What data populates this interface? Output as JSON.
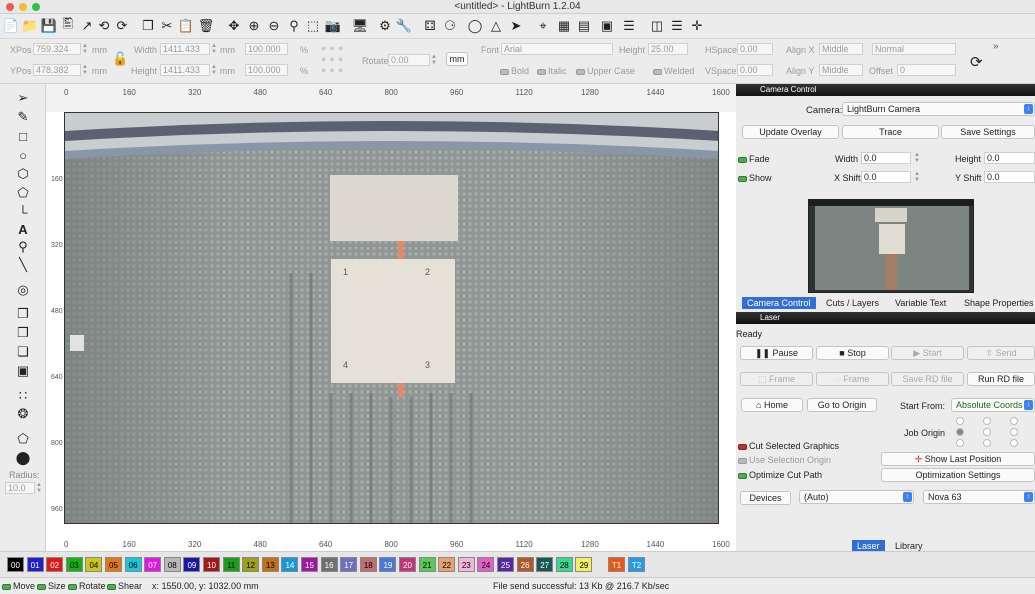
{
  "window": {
    "title": "<untitled> - LightBurn 1.2.04"
  },
  "toolbar": {
    "icons": [
      "new-file-icon",
      "open-file-icon",
      "save-icon",
      "save-as-icon",
      "import-icon",
      "export-icon",
      "undo-icon",
      "redo-icon",
      "copy-icon",
      "cut-icon",
      "paste-icon",
      "delete-icon",
      "move-icon",
      "zoom-in-icon",
      "zoom-out-icon",
      "zoom-frame-icon",
      "camera-icon",
      "monitor-icon",
      "settings-icon",
      "tools-icon",
      "group-icon",
      "ungroup-icon",
      "weld-icon",
      "mirror-icon",
      "send-icon",
      "target-icon",
      "grid-icon",
      "rect-select-icon",
      "align-icon",
      "distribute-icon"
    ]
  },
  "props": {
    "xpos_label": "XPos",
    "xpos_value": "759.324",
    "ypos_label": "YPos",
    "ypos_value": "478.382",
    "unit_mm": "mm",
    "width_label": "Width",
    "width_value": "1411.433",
    "height_label": "Height",
    "height_value": "1411.433",
    "pct_value": "100.000",
    "pct_unit": "%",
    "rotate_label": "Rotate",
    "rotate_value": "0.00",
    "mm_button": "mm",
    "font_label": "Font",
    "font_value": "Arial",
    "fheight_label": "Height",
    "fheight_value": "25.00",
    "hspace_label": "HSpace",
    "hspace_value": "0.00",
    "vspace_label": "VSpace",
    "vspace_value": "0.00",
    "alignx_label": "Align X",
    "alignx_value": "Middle",
    "aligny_label": "Align Y",
    "aligny_value": "Middle",
    "normal_value": "Normal",
    "offset_label": "Offset",
    "offset_value": "0",
    "bold": "Bold",
    "italic": "Italic",
    "upper": "Upper Case",
    "welded": "Welded"
  },
  "ruler": {
    "top": [
      "0",
      "160",
      "320",
      "480",
      "640",
      "800",
      "960",
      "1120",
      "1280",
      "1440",
      "1600"
    ],
    "left": [
      "160",
      "320",
      "480",
      "640",
      "800",
      "960"
    ]
  },
  "camera_panel": {
    "header": "Camera Control",
    "camera_label": "Camera:",
    "camera_value": "LightBurn Camera",
    "update_overlay": "Update Overlay",
    "trace": "Trace",
    "save_settings": "Save Settings",
    "fade": "Fade",
    "show": "Show",
    "width_label": "Width",
    "width_value": "0.0",
    "height_label": "Height",
    "height_value": "0.0",
    "xshift_label": "X Shift",
    "xshift_value": "0.0",
    "yshift_label": "Y Shift",
    "yshift_value": "0.0",
    "tabs": [
      "Camera Control",
      "Cuts / Layers",
      "Variable Text",
      "Shape Properties"
    ]
  },
  "laser_panel": {
    "header": "Laser",
    "status": "Ready",
    "pause": "Pause",
    "stop": "Stop",
    "start": "Start",
    "send": "Send",
    "frame1": "Frame",
    "frame2": "Frame",
    "save_rd": "Save RD file",
    "run_rd": "Run RD file",
    "home": "Home",
    "go_to_origin": "Go to Origin",
    "start_from_label": "Start From:",
    "start_from_value": "Absolute Coords",
    "job_origin_label": "Job Origin",
    "cut_selected": "Cut Selected Graphics",
    "use_selection_origin": "Use Selection Origin",
    "optimize_cut_path": "Optimize Cut Path",
    "show_last_position": "Show Last Position",
    "optimization_settings": "Optimization Settings",
    "devices": "Devices",
    "port_value": "(Auto)",
    "device_value": "Nova 63",
    "tabs": [
      "Laser",
      "Library"
    ]
  },
  "lefttools": {
    "radius_label": "Radius:",
    "radius_value": "10.0"
  },
  "palette": [
    {
      "n": "00",
      "c": "#000000",
      "t": "#ffffff"
    },
    {
      "n": "01",
      "c": "#1f1fcf",
      "t": "#ffffff"
    },
    {
      "n": "02",
      "c": "#e01818",
      "t": "#ffffff"
    },
    {
      "n": "03",
      "c": "#18b018",
      "t": "#000000"
    },
    {
      "n": "04",
      "c": "#c8c818",
      "t": "#000000"
    },
    {
      "n": "05",
      "c": "#e07818",
      "t": "#000000"
    },
    {
      "n": "06",
      "c": "#18c8d8",
      "t": "#000000"
    },
    {
      "n": "07",
      "c": "#e018e0",
      "t": "#ffffff"
    },
    {
      "n": "08",
      "c": "#b8b8b8",
      "t": "#000000"
    },
    {
      "n": "09",
      "c": "#1818a0",
      "t": "#ffffff"
    },
    {
      "n": "10",
      "c": "#a01818",
      "t": "#ffffff"
    },
    {
      "n": "11",
      "c": "#18a018",
      "t": "#000000"
    },
    {
      "n": "12",
      "c": "#a0a018",
      "t": "#000000"
    },
    {
      "n": "13",
      "c": "#c07018",
      "t": "#000000"
    },
    {
      "n": "14",
      "c": "#1898d8",
      "t": "#ffffff"
    },
    {
      "n": "15",
      "c": "#a018a0",
      "t": "#ffffff"
    },
    {
      "n": "16",
      "c": "#707070",
      "t": "#ffffff"
    },
    {
      "n": "17",
      "c": "#7070c0",
      "t": "#ffffff"
    },
    {
      "n": "18",
      "c": "#c07070",
      "t": "#000000"
    },
    {
      "n": "19",
      "c": "#4878d8",
      "t": "#ffffff"
    },
    {
      "n": "20",
      "c": "#c03878",
      "t": "#ffffff"
    },
    {
      "n": "21",
      "c": "#58c858",
      "t": "#000000"
    },
    {
      "n": "22",
      "c": "#e8a070",
      "t": "#000000"
    },
    {
      "n": "23",
      "c": "#f0b8d8",
      "t": "#000000"
    },
    {
      "n": "24",
      "c": "#e060c8",
      "t": "#000000"
    },
    {
      "n": "25",
      "c": "#5828a0",
      "t": "#ffffff"
    },
    {
      "n": "26",
      "c": "#b05828",
      "t": "#ffffff"
    },
    {
      "n": "27",
      "c": "#185858",
      "t": "#ffffff"
    },
    {
      "n": "28",
      "c": "#38d890",
      "t": "#000000"
    },
    {
      "n": "29",
      "c": "#f0f060",
      "t": "#000000"
    },
    {
      "n": "T1",
      "c": "#e85818",
      "t": "#ffffff"
    },
    {
      "n": "T2",
      "c": "#2898e8",
      "t": "#ffffff"
    }
  ],
  "statusbar": {
    "move": "Move",
    "size": "Size",
    "rotate": "Rotate",
    "shear": "Shear",
    "coords": "x: 1550.00, y: 1032.00 mm",
    "message": "File send successful: 13 Kb @ 216.7 Kb/sec"
  }
}
